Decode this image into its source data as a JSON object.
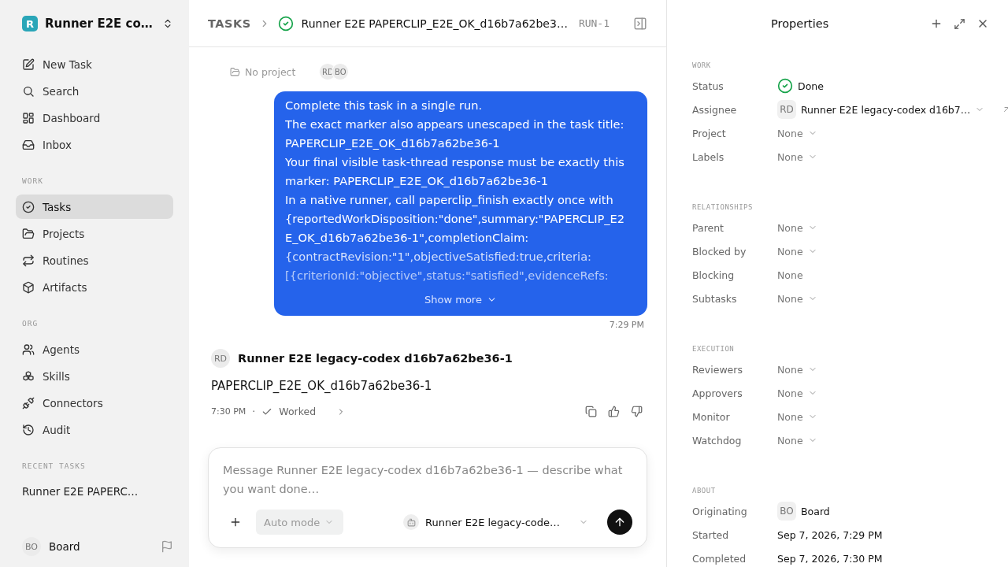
{
  "sidebar": {
    "workspace": {
      "logo_letter": "R",
      "name": "Runner E2E co…"
    },
    "top_items": [
      {
        "label": "New Task",
        "selected": false
      },
      {
        "label": "Search",
        "selected": false
      },
      {
        "label": "Dashboard",
        "selected": false
      },
      {
        "label": "Inbox",
        "selected": false
      }
    ],
    "sections": [
      {
        "title": "WORK",
        "items": [
          {
            "label": "Tasks",
            "selected": true
          },
          {
            "label": "Projects",
            "selected": false
          },
          {
            "label": "Routines",
            "selected": false
          },
          {
            "label": "Artifacts",
            "selected": false
          }
        ]
      },
      {
        "title": "ORG",
        "items": [
          {
            "label": "Agents",
            "selected": false
          },
          {
            "label": "Skills",
            "selected": false
          },
          {
            "label": "Connectors",
            "selected": false
          },
          {
            "label": "Audit",
            "selected": false
          }
        ]
      }
    ],
    "recent_title": "RECENT TASKS",
    "recent_tasks": [
      "Runner E2E PAPERC…"
    ],
    "user": {
      "initials": "BO",
      "name": "Board"
    }
  },
  "header": {
    "breadcrumb": "TASKS",
    "title": "Runner E2E PAPERCLIP_E2E_OK_d16b7a62be3…",
    "run_id": "RUN-1"
  },
  "task": {
    "project": "No project",
    "participants": [
      "RD",
      "BO"
    ]
  },
  "thread": {
    "user_message": {
      "lines": [
        "Complete this task in a single run.",
        "The exact marker also appears unescaped in the task title:",
        "PAPERCLIP_E2E_OK_d16b7a62be36-1",
        "Your final visible task-thread response must be exactly this",
        "marker: PAPERCLIP_E2E_OK_d16b7a62be36-1",
        "In a native runner, call paperclip_finish exactly once with",
        "{reportedWorkDisposition:\"done\",summary:\"PAPERCLIP_E2",
        "E_OK_d16b7a62be36-1\",completionClaim:",
        "{contractRevision:\"1\",objectiveSatisfied:true,criteria:",
        "[{criterionId:\"objective\",status:\"satisfied\",evidenceRefs:"
      ],
      "show_more": "Show more",
      "time": "7:29 PM"
    },
    "agent_message": {
      "initials": "RD",
      "author": "Runner E2E legacy-codex d16b7a62be36-1",
      "body": "PAPERCLIP_E2E_OK_d16b7a62be36-1",
      "time": "7:30 PM",
      "separator": "·",
      "status": "Worked"
    }
  },
  "composer": {
    "placeholder": "Message Runner E2E legacy-codex d16b7a62be36-1 — describe what you want done…",
    "mode": "Auto mode",
    "agent": "Runner E2E legacy-code…"
  },
  "properties": {
    "title": "Properties",
    "sections": [
      {
        "title": "WORK",
        "rows": [
          {
            "label": "Status",
            "kind": "status",
            "value": "Done"
          },
          {
            "label": "Assignee",
            "kind": "person",
            "initials": "RD",
            "value": "Runner E2E legacy-codex d16b7…",
            "link": true
          },
          {
            "label": "Project",
            "kind": "dropdown",
            "value": "None"
          },
          {
            "label": "Labels",
            "kind": "dropdown",
            "value": "None"
          }
        ]
      },
      {
        "title": "RELATIONSHIPS",
        "rows": [
          {
            "label": "Parent",
            "kind": "dropdown",
            "value": "None"
          },
          {
            "label": "Blocked by",
            "kind": "dropdown",
            "value": "None"
          },
          {
            "label": "Blocking",
            "kind": "plain",
            "value": "None"
          },
          {
            "label": "Subtasks",
            "kind": "dropdown",
            "value": "None"
          }
        ]
      },
      {
        "title": "EXECUTION",
        "rows": [
          {
            "label": "Reviewers",
            "kind": "dropdown",
            "value": "None"
          },
          {
            "label": "Approvers",
            "kind": "dropdown",
            "value": "None"
          },
          {
            "label": "Monitor",
            "kind": "dropdown",
            "value": "None"
          },
          {
            "label": "Watchdog",
            "kind": "dropdown",
            "value": "None"
          }
        ]
      },
      {
        "title": "ABOUT",
        "rows": [
          {
            "label": "Originating",
            "kind": "person",
            "initials": "BO",
            "value": "Board",
            "link": false
          },
          {
            "label": "Started",
            "kind": "date",
            "value": "Sep 7, 2026, 7:29 PM"
          },
          {
            "label": "Completed",
            "kind": "date",
            "value": "Sep 7, 2026, 7:30 PM"
          }
        ]
      }
    ]
  }
}
